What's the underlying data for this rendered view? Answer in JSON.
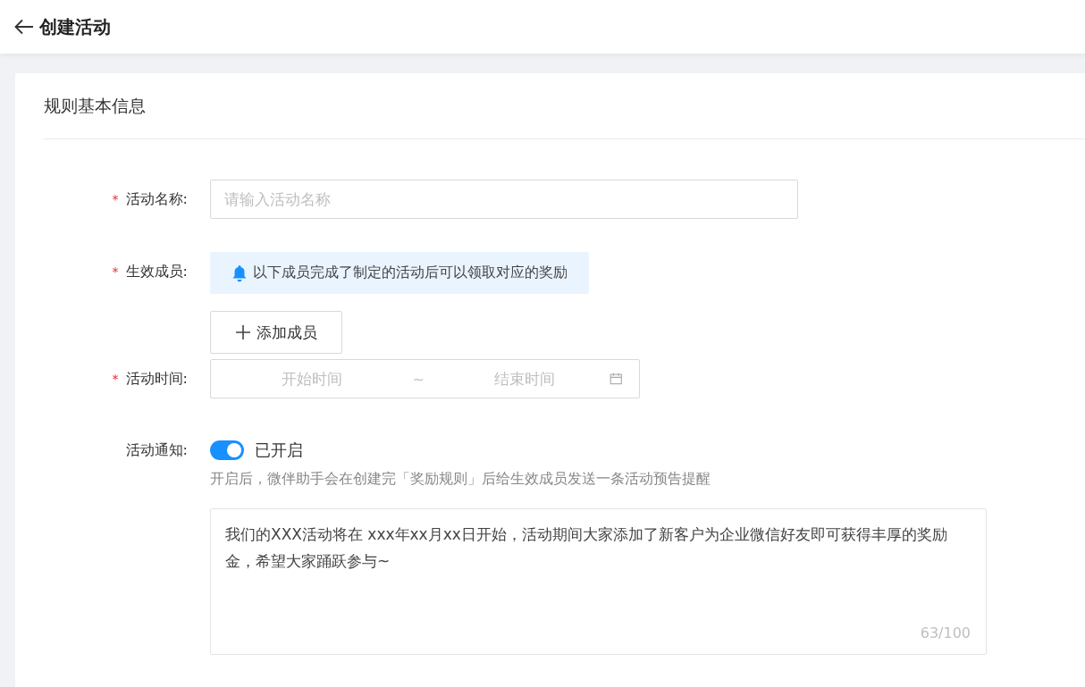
{
  "header": {
    "title": "创建活动"
  },
  "section": {
    "title": "规则基本信息"
  },
  "fields": [
    {
      "kind": "text",
      "label": "活动名称:",
      "required": true,
      "mark": "*",
      "placeholder": "请输入活动名称"
    },
    {
      "kind": "members",
      "label": "生效成员:",
      "required": true,
      "mark": "*",
      "notice": "以下成员完成了制定的活动后可以领取对应的奖励",
      "button": "添加成员"
    },
    {
      "kind": "daterange",
      "label": "活动时间:",
      "required": true,
      "mark": "*",
      "start_placeholder": "开始时间",
      "separator": "~",
      "end_placeholder": "结束时间"
    },
    {
      "kind": "switch",
      "label": "活动通知:",
      "on": true,
      "status": "已开启",
      "hint": "开启后，微伴助手会在创建完「奖励规则」后给生效成员发送一条活动预告提醒",
      "message": "我们的XXX活动将在 xxx年xx月xx日开始，活动期间大家添加了新客户为企业微信好友即可获得丰厚的奖励金，希望大家踊跃参与~",
      "count": "63/100"
    }
  ]
}
